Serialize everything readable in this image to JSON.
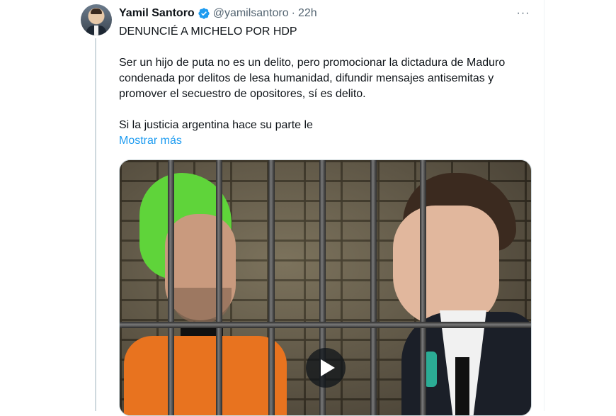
{
  "author": {
    "name": "Yamil Santoro",
    "handle": "@yamilsantoro",
    "separator": "·",
    "time": "22h",
    "verified_color": "#1d9bf0"
  },
  "tweet": {
    "headline": "DENUNCIÉ A MICHELO POR HDP",
    "paragraph1": "Ser un hijo de puta no es un delito, pero promocionar la dictadura de Maduro condenada por delitos de lesa humanidad, difundir mensajes antisemitas y promover el secuestro de opositores, sí es delito.",
    "paragraph2": "Si la justicia argentina hace su parte le",
    "show_more": "Mostrar más"
  },
  "menu": {
    "more_label": "···"
  },
  "icons": {
    "verified": "verified-badge-icon",
    "more": "more-options-icon",
    "play": "play-icon"
  },
  "colors": {
    "text": "#0f1419",
    "secondary": "#536471",
    "link": "#1d9bf0",
    "thread_line": "#cfd9de"
  }
}
